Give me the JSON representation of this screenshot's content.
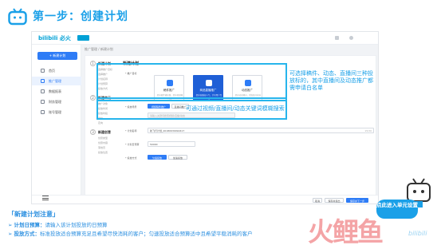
{
  "header": {
    "title": "第一步：创建计划"
  },
  "app": {
    "logo": "bilibili 必火",
    "crumb": "推广管理 / 新建计划",
    "new_plan": "+ 新建计划",
    "sidebar": [
      "首页",
      "推广管理",
      "数据报表",
      "财务管理",
      "账号管理"
    ],
    "steps": [
      {
        "n": "1",
        "label": "新建计划",
        "subs": [
          "选择推广目标",
          "选择推广",
          "计划名称",
          "计划预算",
          "投放方式"
        ]
      },
      {
        "n": "2",
        "label": "新建单元",
        "subs": [
          "推广对象",
          "投放时间",
          "投放时段",
          "出价",
          "定向"
        ]
      },
      {
        "n": "3",
        "label": "新建创意",
        "subs": [
          "创意类型",
          "创意内容",
          "落地页",
          "投放位置"
        ]
      }
    ],
    "form_title": "新建计划",
    "goal_label": "* 推广目标",
    "goals": [
      {
        "title": "稿件推广",
        "desc": "提升稿件播放量，提升视频曝光度"
      },
      {
        "title": "商品直播推广",
        "desc": "提升直播间人气，引导用户互动"
      },
      {
        "title": "动态推广",
        "desc": "提升动态曝光，增加账号粉丝"
      }
    ],
    "scene_label": "* 投放场景",
    "scene_tabs": [
      "视频稿件推广",
      "直播间推广"
    ],
    "keyword_placeholder": "请输入关键词搜索视频/直播/动态",
    "name_label": "* 计划名称",
    "name_value": "新飞行计划_20180930092417",
    "name_count": "15/30",
    "budget_label": "* 计划日预算",
    "budget_value": "50000",
    "mode_label": "* 投放方式",
    "mode_tabs": [
      "匀速投放",
      "加速投放"
    ],
    "bottom_buttons": [
      "取消",
      "保存并退出",
      "保存并下一步"
    ]
  },
  "annotations": {
    "a1": "可选择稿件、动态、直播间三种投放标的，其中直播间及动态推广都需申请白名单",
    "a2": "可通过视频/直播间/动态关键词模糊搜索"
  },
  "notes": {
    "title": "「新建计划注意」",
    "n1_key": "计划日预算：",
    "n1": "请输入该计划投放的日预算",
    "n2_key": "投放方式：",
    "n2": "标准投放适合预算充足且希望尽快消耗的客户；匀速投放适合预算适中且希望平稳消耗的客户"
  },
  "promo": {
    "bubble": "点此进入单元设置",
    "wm": "火鲤鱼",
    "wm2": "bilibili"
  },
  "colors": {
    "accent": "#1aa0e8",
    "primary": "#2e7cf6",
    "highlight_border": "#27b5ec"
  }
}
